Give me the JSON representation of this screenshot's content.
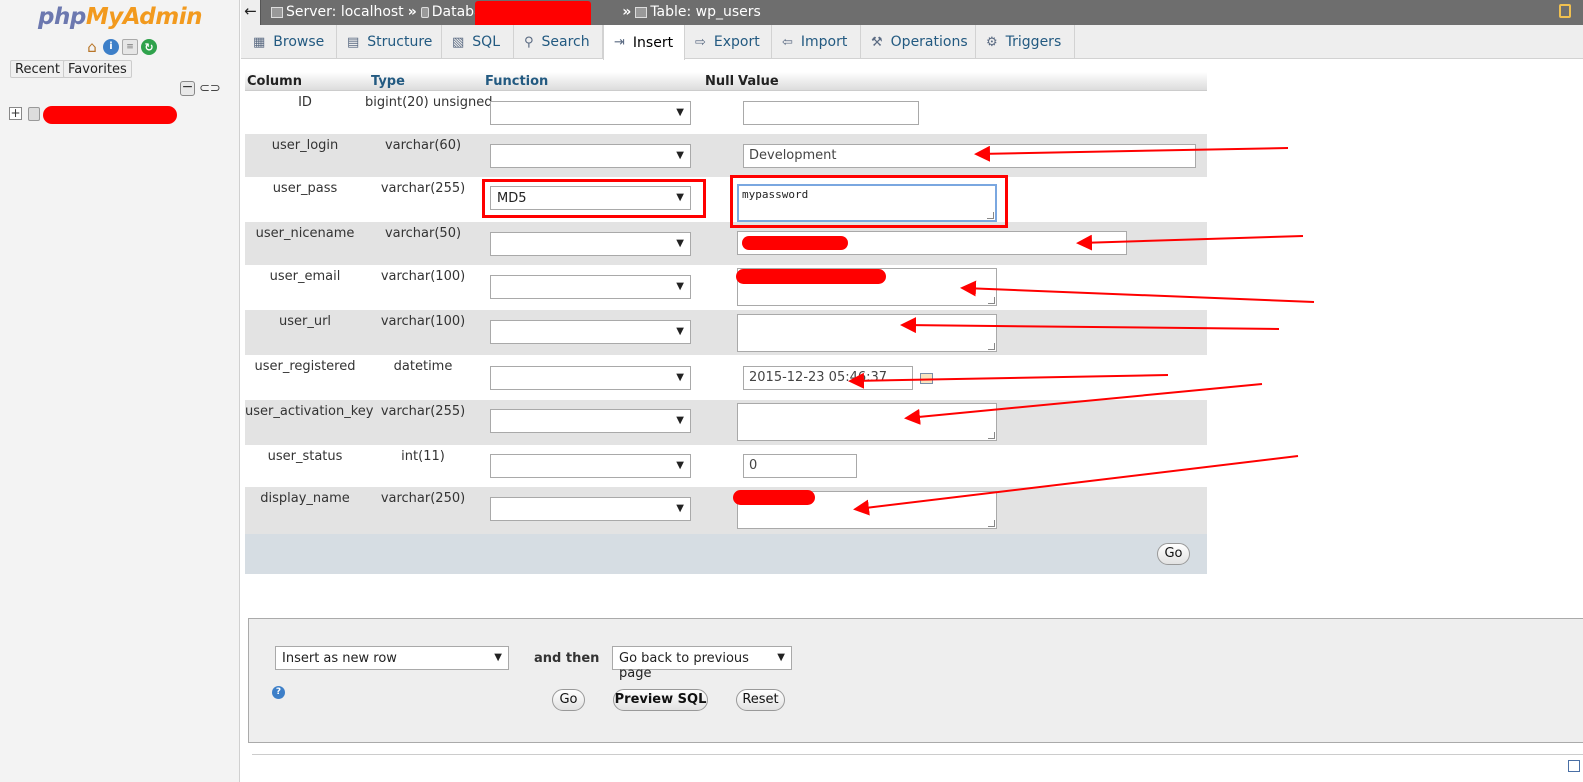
{
  "logo": {
    "part1": "php",
    "part2": "MyAdmin"
  },
  "nav": {
    "recent": "Recent",
    "favorites": "Favorites"
  },
  "topbar": {
    "back": "←",
    "server": "Server: localhost",
    "database": "Database:",
    "table": "Table: wp_users",
    "sep": "»"
  },
  "tabs": [
    {
      "label": "Browse",
      "icon": "browse-icon"
    },
    {
      "label": "Structure",
      "icon": "structure-icon"
    },
    {
      "label": "SQL",
      "icon": "sql-icon"
    },
    {
      "label": "Search",
      "icon": "search-icon"
    },
    {
      "label": "Insert",
      "icon": "insert-icon"
    },
    {
      "label": "Export",
      "icon": "export-icon"
    },
    {
      "label": "Import",
      "icon": "import-icon"
    },
    {
      "label": "Operations",
      "icon": "wrench-icon"
    },
    {
      "label": "Triggers",
      "icon": "triggers-icon"
    }
  ],
  "table_header": {
    "column": "Column",
    "type": "Type",
    "function": "Function",
    "null": "Null",
    "value": "Value"
  },
  "rows": [
    {
      "column": "ID",
      "type": "bigint(20) unsigned",
      "function": "",
      "value": ""
    },
    {
      "column": "user_login",
      "type": "varchar(60)",
      "function": "",
      "value": "Development"
    },
    {
      "column": "user_pass",
      "type": "varchar(255)",
      "function": "MD5",
      "value": "mypassword"
    },
    {
      "column": "user_nicename",
      "type": "varchar(50)",
      "function": "",
      "value": ""
    },
    {
      "column": "user_email",
      "type": "varchar(100)",
      "function": "",
      "value": ""
    },
    {
      "column": "user_url",
      "type": "varchar(100)",
      "function": "",
      "value": ""
    },
    {
      "column": "user_registered",
      "type": "datetime",
      "function": "",
      "value": "2015-12-23 05:46:37"
    },
    {
      "column": "user_activation_key",
      "type": "varchar(255)",
      "function": "",
      "value": ""
    },
    {
      "column": "user_status",
      "type": "int(11)",
      "function": "",
      "value": "0"
    },
    {
      "column": "display_name",
      "type": "varchar(250)",
      "function": "",
      "value": ""
    }
  ],
  "go_label": "Go",
  "bottom": {
    "insert_mode": "Insert as new row",
    "and_then": "and then",
    "after_action": "Go back to previous page",
    "go": "Go",
    "preview": "Preview SQL",
    "reset": "Reset"
  },
  "colors": {
    "accent_link": "#235a81",
    "annotation_red": "#ff0000"
  }
}
